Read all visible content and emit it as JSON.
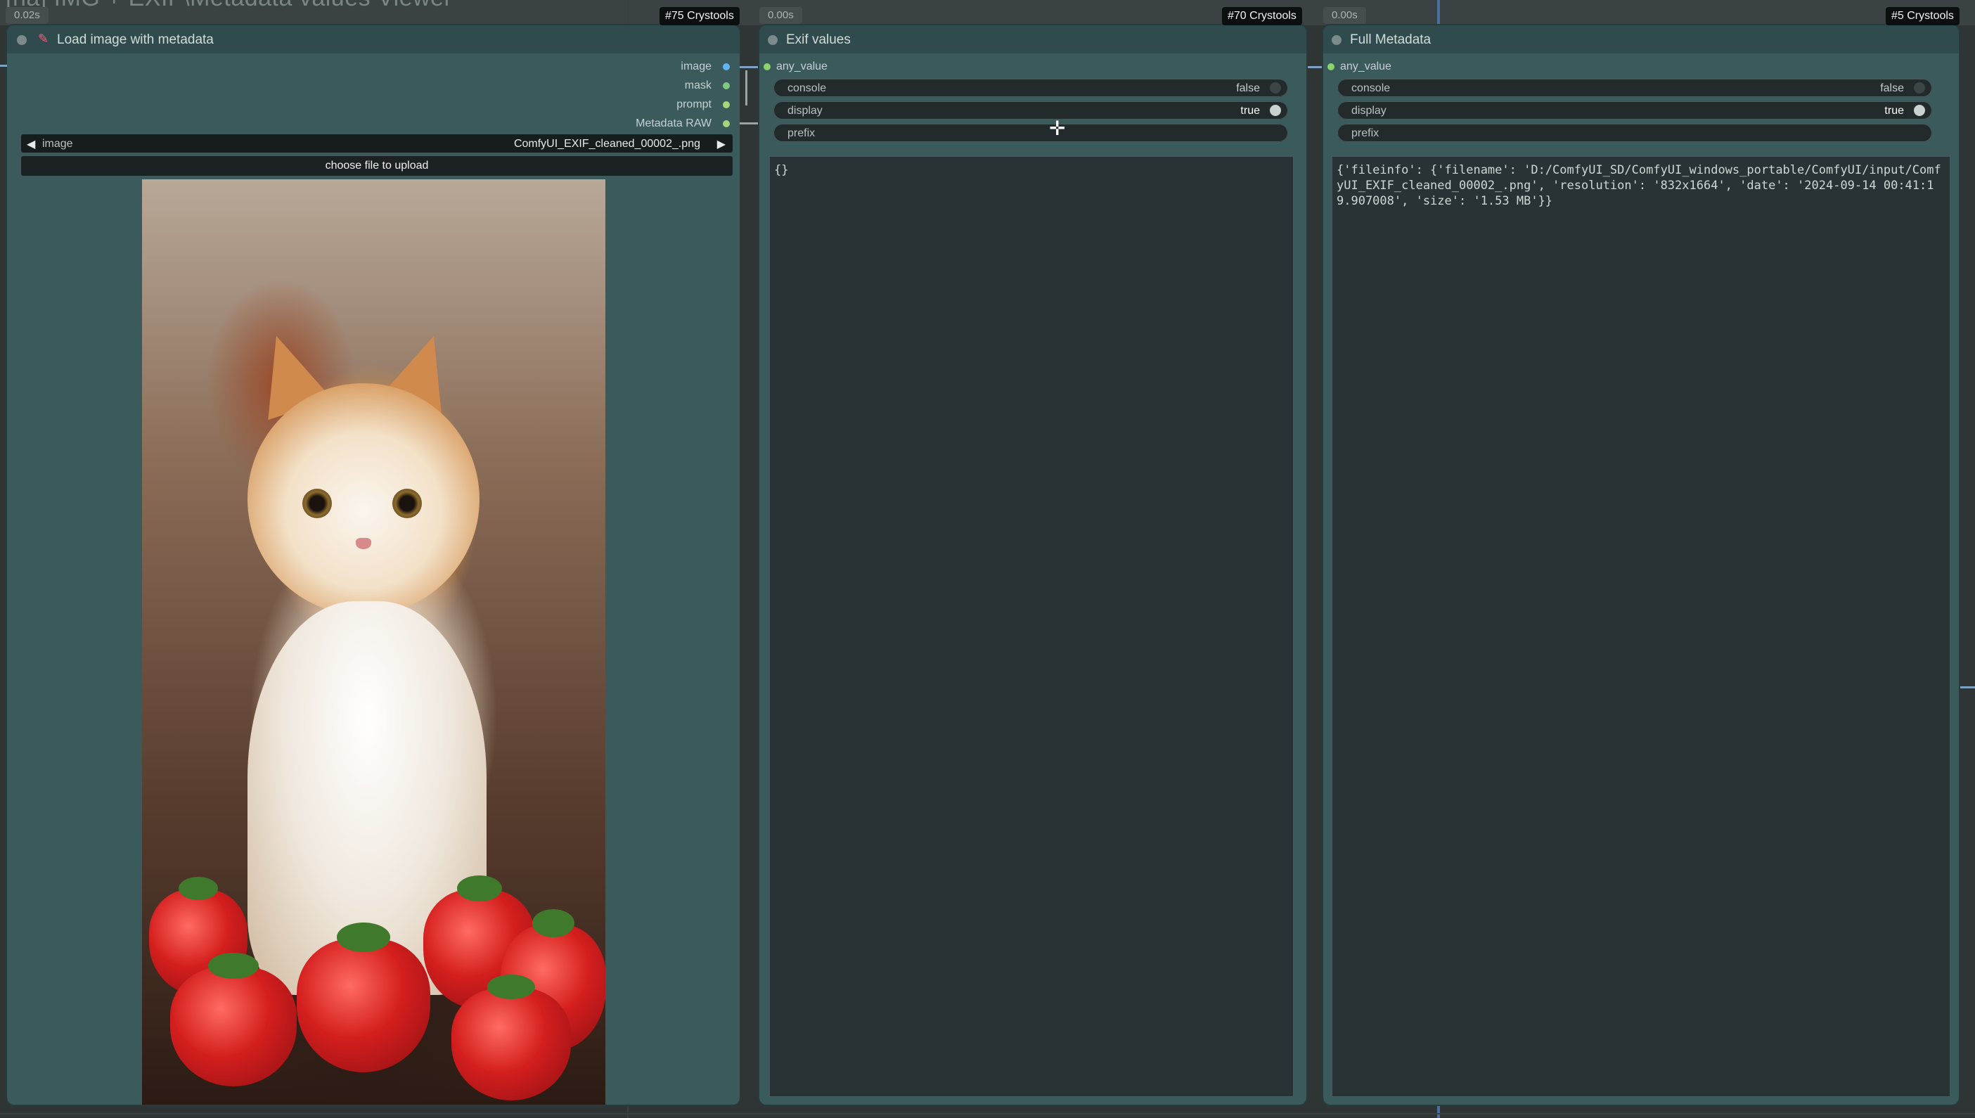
{
  "group": {
    "title": "[na] IMG + EXIF\\Metadata values Viewer"
  },
  "nodes": {
    "load": {
      "title": "Load image with metadata",
      "time": "0.02s",
      "badge": "#75 Crystools",
      "outputs": [
        {
          "label": "image",
          "color": "#64b5f6"
        },
        {
          "label": "mask",
          "color": "#81c784"
        },
        {
          "label": "prompt",
          "color": "#a5d67b"
        },
        {
          "label": "Metadata RAW",
          "color": "#a5d67b"
        }
      ],
      "image_widget": {
        "label": "image",
        "value": "ComfyUI_EXIF_cleaned_00002_.png"
      },
      "upload_label": "choose file to upload"
    },
    "exif": {
      "title": "Exif values",
      "time": "0.00s",
      "badge": "#70 Crystools",
      "input": "any_value",
      "console": {
        "label": "console",
        "value": "false"
      },
      "display": {
        "label": "display",
        "value": "true"
      },
      "prefix": {
        "label": "prefix",
        "value": ""
      },
      "output_text": "{}"
    },
    "full": {
      "title": "Full Metadata",
      "time": "0.00s",
      "badge": "#5 Crystools",
      "input": "any_value",
      "console": {
        "label": "console",
        "value": "false"
      },
      "display": {
        "label": "display",
        "value": "true"
      },
      "prefix": {
        "label": "prefix",
        "value": ""
      },
      "output_text": "{'fileinfo': {'filename': 'D:/ComfyUI_SD/ComfyUI_windows_portable/ComfyUI/input/ComfyUI_EXIF_cleaned_00002_.png', 'resolution': '832x1664', 'date': '2024-09-14 00:41:19.907008', 'size': '1.53 MB'}}"
    }
  },
  "colors": {
    "node_body": "#3b5a5c",
    "node_header": "#2f4b4d",
    "toggle_on": "#c9d1d1",
    "toggle_off": "#3d4647"
  }
}
